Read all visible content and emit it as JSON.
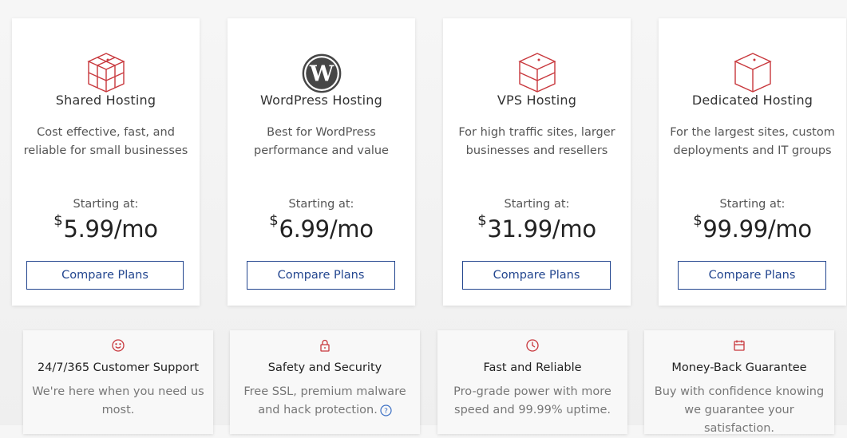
{
  "colors": {
    "accent": "#c8373c",
    "button": "#23468f"
  },
  "plans": [
    {
      "icon": "multi-server-box-icon",
      "title": "Shared Hosting",
      "desc_line1": "Cost effective, fast, and",
      "desc_line2": "reliable for small businesses",
      "starting": "Starting at:",
      "currency": "$",
      "price": "5.99",
      "period": "/mo",
      "button": "Compare Plans"
    },
    {
      "icon": "wordpress-icon",
      "title": "WordPress Hosting",
      "desc_line1": "Best for WordPress",
      "desc_line2": "performance and value",
      "starting": "Starting at:",
      "currency": "$",
      "price": "6.99",
      "period": "/mo",
      "button": "Compare Plans"
    },
    {
      "icon": "vps-box-icon",
      "title": "VPS Hosting",
      "desc_line1": "For high traffic sites, larger",
      "desc_line2": "businesses and resellers",
      "starting": "Starting at:",
      "currency": "$",
      "price": "31.99",
      "period": "/mo",
      "button": "Compare Plans"
    },
    {
      "icon": "dedicated-box-icon",
      "title": "Dedicated Hosting",
      "desc_line1": "For the largest sites, custom",
      "desc_line2": "deployments and IT groups",
      "starting": "Starting at:",
      "currency": "$",
      "price": "99.99",
      "period": "/mo",
      "button": "Compare Plans"
    }
  ],
  "features": [
    {
      "icon": "smiley-icon",
      "title": "24/7/365 Customer Support",
      "desc_line1": "We're here when you need us",
      "desc_line2": "most."
    },
    {
      "icon": "lock-icon",
      "title": "Safety and Security",
      "desc_line1": "Free SSL, premium malware",
      "desc_line2": "and hack protection."
    },
    {
      "icon": "clock-icon",
      "title": "Fast and Reliable",
      "desc_line1": "Pro-grade power with more",
      "desc_line2": "speed and 99.99% uptime."
    },
    {
      "icon": "calendar-icon",
      "title": "Money-Back Guarantee",
      "desc_line1": "Buy with confidence knowing",
      "desc_line2": "we guarantee your satisfaction."
    }
  ]
}
